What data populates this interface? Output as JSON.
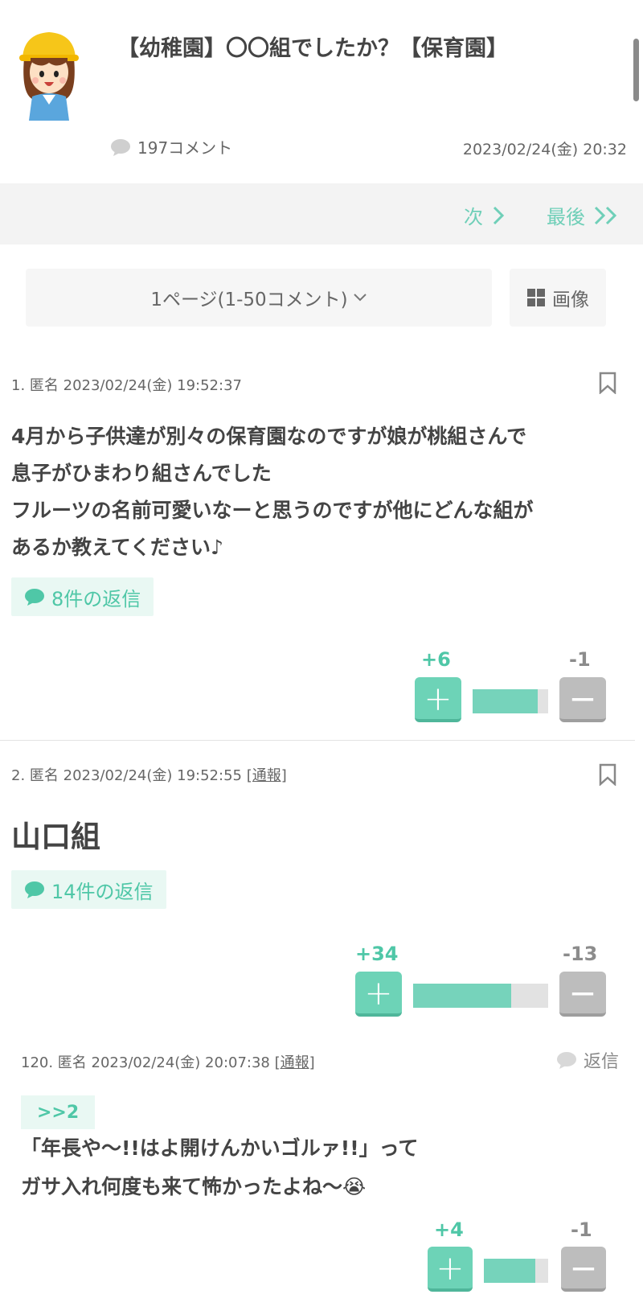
{
  "header": {
    "title": "【幼稚園】〇〇組でしたか？【保育園】",
    "comment_count": "197コメント",
    "date": "2023/02/24(金) 20:32",
    "avatar_icon": "kindergarten-girl-avatar",
    "comment_icon": "speech-bubble-icon"
  },
  "nav": {
    "next_label": "次",
    "last_label": "最後"
  },
  "pager": {
    "select_value": "1ページ(1-50コメント)",
    "image_button_label": "画像"
  },
  "comments": [
    {
      "meta": "1. 匿名 2023/02/24(金) 19:52:37",
      "lines": [
        "4月から子供達が別々の保育園なのですが娘が桃組さんで",
        "息子がひまわり組さんでした",
        "フルーツの名前可愛いなーと思うのですが他にどんな組が",
        "あるか教えてください♪"
      ],
      "replies_label": "8件の返信",
      "plus_label": "+6",
      "minus_label": "-1",
      "plus": 6,
      "minus": 1
    },
    {
      "meta": "2. 匿名 2023/02/24(金) 19:52:55",
      "report_label": "[通報]",
      "body": "山口組",
      "replies_label": "14件の返信",
      "plus_label": "+34",
      "minus_label": "-13",
      "plus": 34,
      "minus": 13
    }
  ],
  "reply": {
    "meta": "120. 匿名 2023/02/24(金) 20:07:38",
    "report_label": "[通報]",
    "reply_button_label": "返信",
    "anchor": ">>2",
    "lines": [
      "「年長や〜!!はよ開けんかいゴルァ!!」って",
      "ガサ入れ何度も来て怖かったよね〜😭"
    ],
    "plus_label": "+4",
    "minus_label": "-1",
    "plus": 4,
    "minus": 1
  },
  "colors": {
    "accent": "#4fc7a7",
    "bar_fill": "#76d3bb",
    "minus_button": "#bdbdbd"
  }
}
